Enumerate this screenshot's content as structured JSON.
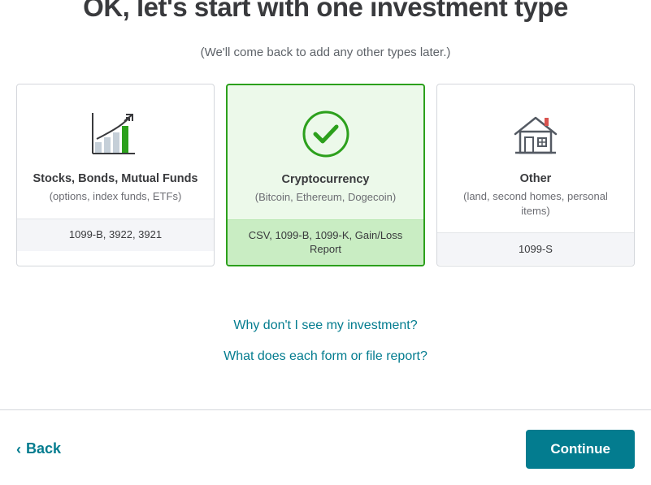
{
  "heading": "OK, let's start with one investment type",
  "subheading": "(We'll come back to add any other types later.)",
  "cards": [
    {
      "title": "Stocks, Bonds, Mutual Funds",
      "subtitle": "(options, index funds, ETFs)",
      "footer": "1099-B, 3922, 3921",
      "selected": false,
      "icon": "bar-growth-icon"
    },
    {
      "title": "Cryptocurrency",
      "subtitle": "(Bitcoin, Ethereum, Dogecoin)",
      "footer": "CSV, 1099-B, 1099-K, Gain/Loss Report",
      "selected": true,
      "icon": "check-circle-icon"
    },
    {
      "title": "Other",
      "subtitle": "(land, second homes, personal items)",
      "footer": "1099-S",
      "selected": false,
      "icon": "house-icon"
    }
  ],
  "help_links": {
    "link1": "Why don't I see my investment?",
    "link2": "What does each form or file report?"
  },
  "nav": {
    "back_label": "Back",
    "continue_label": "Continue"
  }
}
